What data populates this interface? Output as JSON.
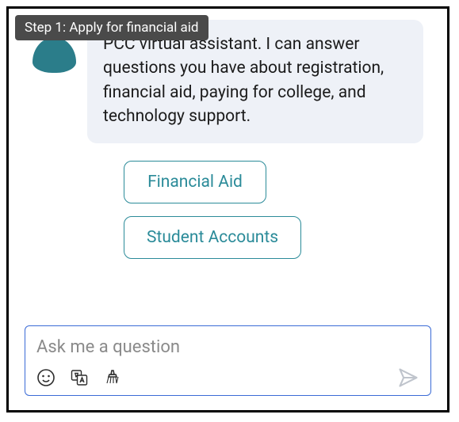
{
  "tooltip": "Step 1: Apply for financial aid",
  "message": {
    "text": "PCC virtual assistant. I can answer questions you have about registration, financial aid, paying for college, and technology support."
  },
  "quick_replies": [
    "Financial Aid",
    "Student Accounts"
  ],
  "input": {
    "placeholder": "Ask me a question"
  },
  "colors": {
    "accent": "#2b8b99",
    "input_border": "#3b6bd6",
    "bubble_bg": "#eef1f7"
  }
}
